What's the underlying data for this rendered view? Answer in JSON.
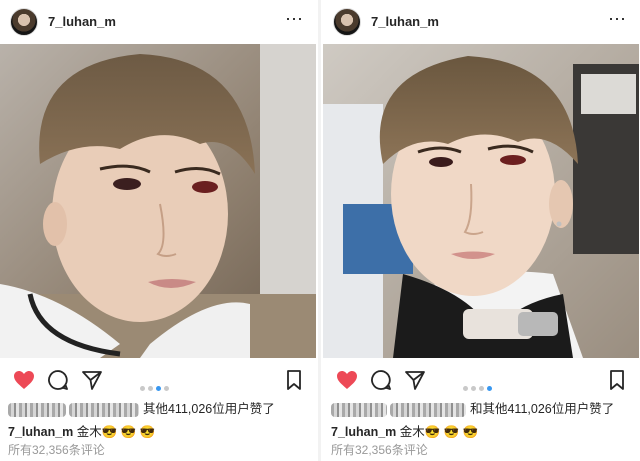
{
  "posts": [
    {
      "username": "7_luhan_m",
      "more_icon": "⋯",
      "likes_suffix": "其他411,026位用户赞了",
      "caption_user": "7_luhan_m",
      "caption_text": "金木😎 😎 😎",
      "comments": "所有32,356条评论"
    },
    {
      "username": "7_luhan_m",
      "more_icon": "⋯",
      "likes_suffix": "和其他411,026位用户赞了",
      "caption_user": "7_luhan_m",
      "caption_text": "金木😎 😎 😎",
      "comments": "所有32,356条评论"
    }
  ],
  "icons": [
    "heart-icon",
    "comment-icon",
    "share-icon",
    "bookmark-icon"
  ],
  "colors": {
    "like": "#ed4956",
    "carousel_active": "#3897f0",
    "muted": "#999999"
  }
}
